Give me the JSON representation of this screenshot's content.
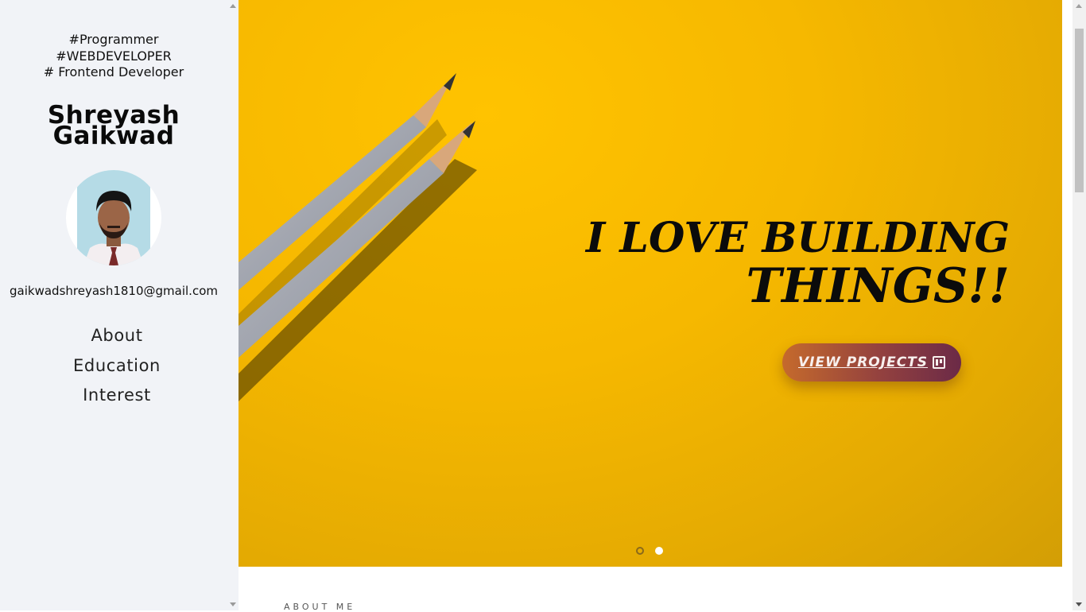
{
  "sidebar": {
    "tags": [
      "#Programmer",
      "#WEBDEVELOPER",
      "# Frontend Developer"
    ],
    "name_line1": "Shreyash",
    "name_line2": "Gaikwad",
    "email": "gaikwadshreyash1810@gmail.com",
    "nav": [
      {
        "label": "About"
      },
      {
        "label": "Education"
      },
      {
        "label": "Interest"
      }
    ]
  },
  "hero": {
    "headline_line1": "I LOVE BUILDING",
    "headline_line2": "THINGS!!",
    "cta_label": "VIEW PROJECTS",
    "cta_icon": "kanban-icon",
    "slides": 2,
    "active_slide": 2,
    "background_color": "#f6b800"
  },
  "sections": {
    "about_label": "ABOUT ME"
  }
}
